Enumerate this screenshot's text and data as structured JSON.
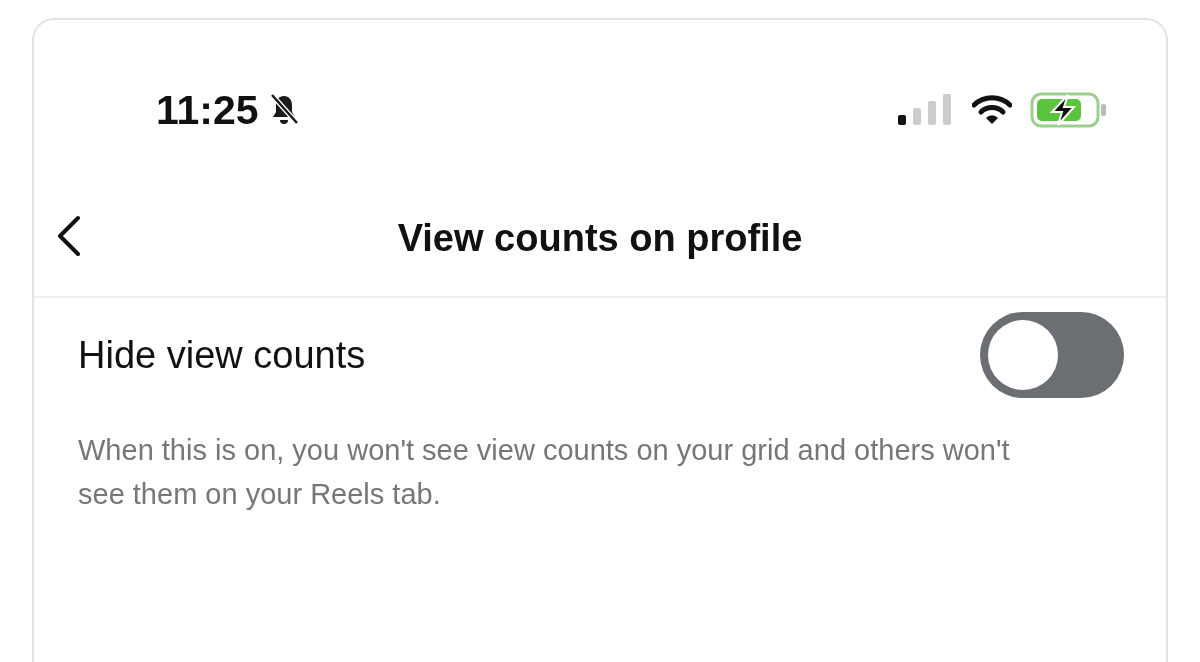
{
  "status_bar": {
    "time": "11:25"
  },
  "header": {
    "title": "View counts on profile"
  },
  "settings": [
    {
      "label": "Hide view counts",
      "on": false,
      "description": "When this is on, you won't see view counts on your grid and others won't see them on your Reels tab."
    }
  ]
}
